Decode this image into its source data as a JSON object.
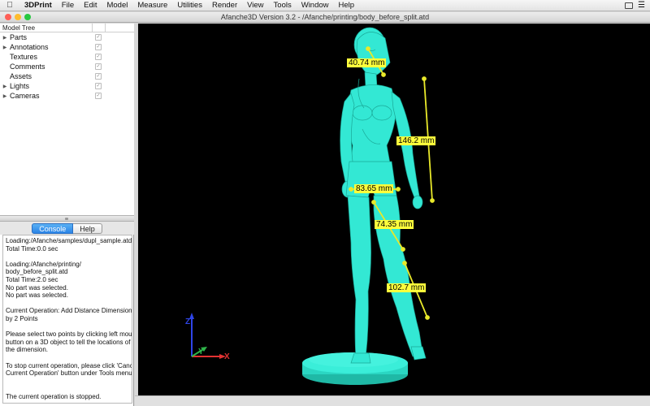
{
  "menubar": {
    "items": [
      "3DPrint",
      "File",
      "Edit",
      "Model",
      "Measure",
      "Utilities",
      "Render",
      "View",
      "Tools",
      "Window",
      "Help"
    ]
  },
  "window": {
    "title": "Afanche3D Version 3.2 - /Afanche/printing/body_before_split.atd"
  },
  "model_tree": {
    "header": "Model Tree",
    "items": [
      {
        "label": "Parts",
        "expandable": true
      },
      {
        "label": "Annotations",
        "expandable": true
      },
      {
        "label": "Textures",
        "expandable": false
      },
      {
        "label": "Comments",
        "expandable": false
      },
      {
        "label": "Assets",
        "expandable": false
      },
      {
        "label": "Lights",
        "expandable": true
      },
      {
        "label": "Cameras",
        "expandable": true
      }
    ],
    "check_glyph": "✓"
  },
  "panel_tabs": {
    "console": "Console",
    "help": "Help"
  },
  "console": {
    "lines": [
      "Loading:/Afanche/samples/dupl_sample.atd",
      "Total Time:0.0 sec",
      "",
      "Loading:/Afanche/printing/",
      "body_before_split.atd",
      "Total Time:2.0 sec",
      "No part was selected.",
      "No part was selected.",
      "",
      "Current Operation: Add Distance Dimension",
      "by 2 Points",
      "",
      "Please select two points by clicking left mouse",
      "button on a 3D object to tell the locations of",
      "the dimension.",
      "",
      "To stop current operation, please click 'Cancel",
      "Current Operation' button under Tools menu.",
      "",
      "",
      "The current operation is stopped."
    ]
  },
  "measurements": [
    {
      "label": "40.74 mm"
    },
    {
      "label": "146.2 mm"
    },
    {
      "label": "83.65 mm"
    },
    {
      "label": "74.35 mm"
    },
    {
      "label": "102.7 mm"
    }
  ],
  "axes": {
    "x": "X",
    "y": "Y",
    "z": "Z"
  },
  "colors": {
    "model": "#33e8d4",
    "measure_label": "#ffff3c",
    "measure_line": "#e9e92a",
    "axis_x": "#e33232",
    "axis_y": "#2fb54a",
    "axis_z": "#2f45e8",
    "tab_active": "#3b95ee"
  }
}
